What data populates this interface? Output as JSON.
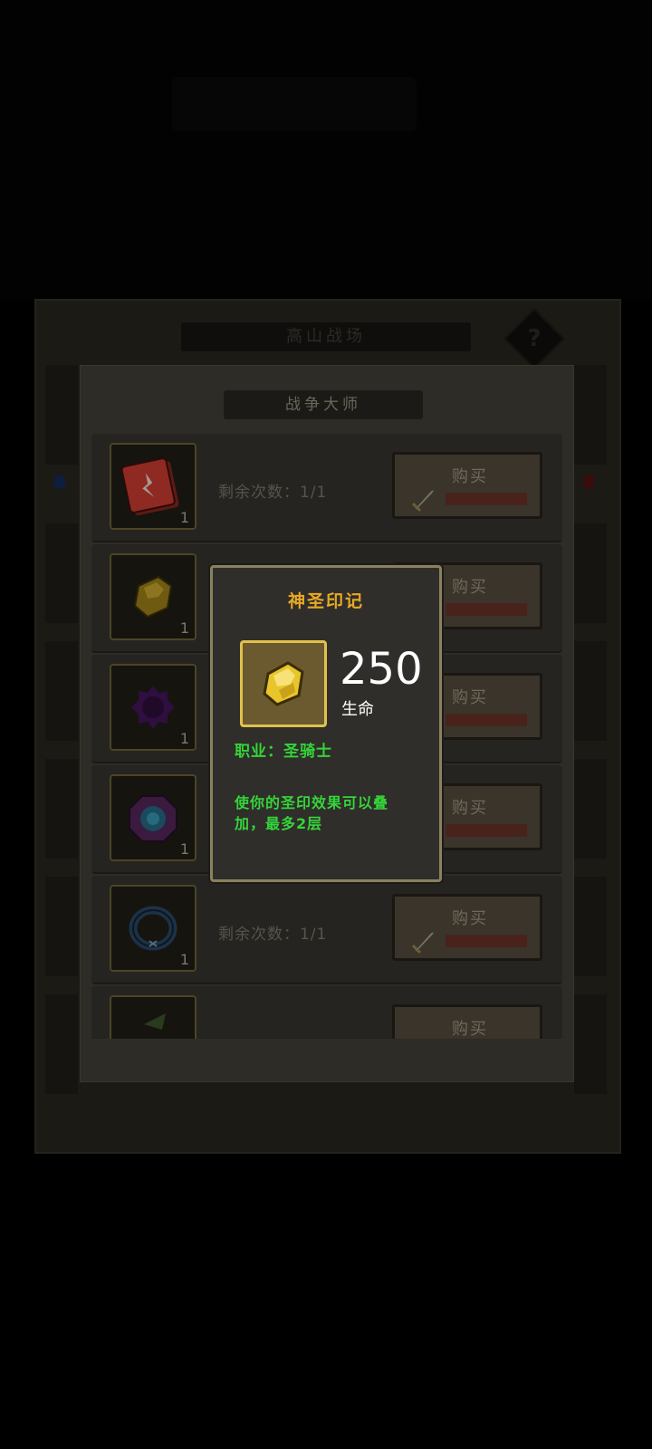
{
  "background": {
    "outer_title": "高山战场",
    "help_label": "?"
  },
  "shop": {
    "title": "战争大师",
    "items": [
      {
        "icon": "red-book-icon",
        "count": "1",
        "remaining": "剩余次数：1/1",
        "buy_label": "购买"
      },
      {
        "icon": "gold-sigil-icon",
        "count": "1",
        "buy_label": "购买"
      },
      {
        "icon": "purple-orb-icon",
        "count": "1",
        "buy_label": "购买"
      },
      {
        "icon": "blue-gem-icon",
        "count": "1",
        "buy_label": "购买"
      },
      {
        "icon": "blue-ring-icon",
        "count": "1",
        "remaining": "剩余次数：1/1",
        "buy_label": "购买"
      },
      {
        "icon": "green-item-icon",
        "count": "",
        "buy_label": "购买"
      }
    ]
  },
  "popup": {
    "title": "神圣印记",
    "value": "250",
    "stat": "生命",
    "class_label": "职业：圣骑士",
    "description": "使你的圣印效果可以叠加，最多2层",
    "icon": "gold-sigil-icon"
  },
  "colors": {
    "popup_title": "#e8a925",
    "green_text": "#35d43a",
    "gold_border": "#e0c14d"
  }
}
